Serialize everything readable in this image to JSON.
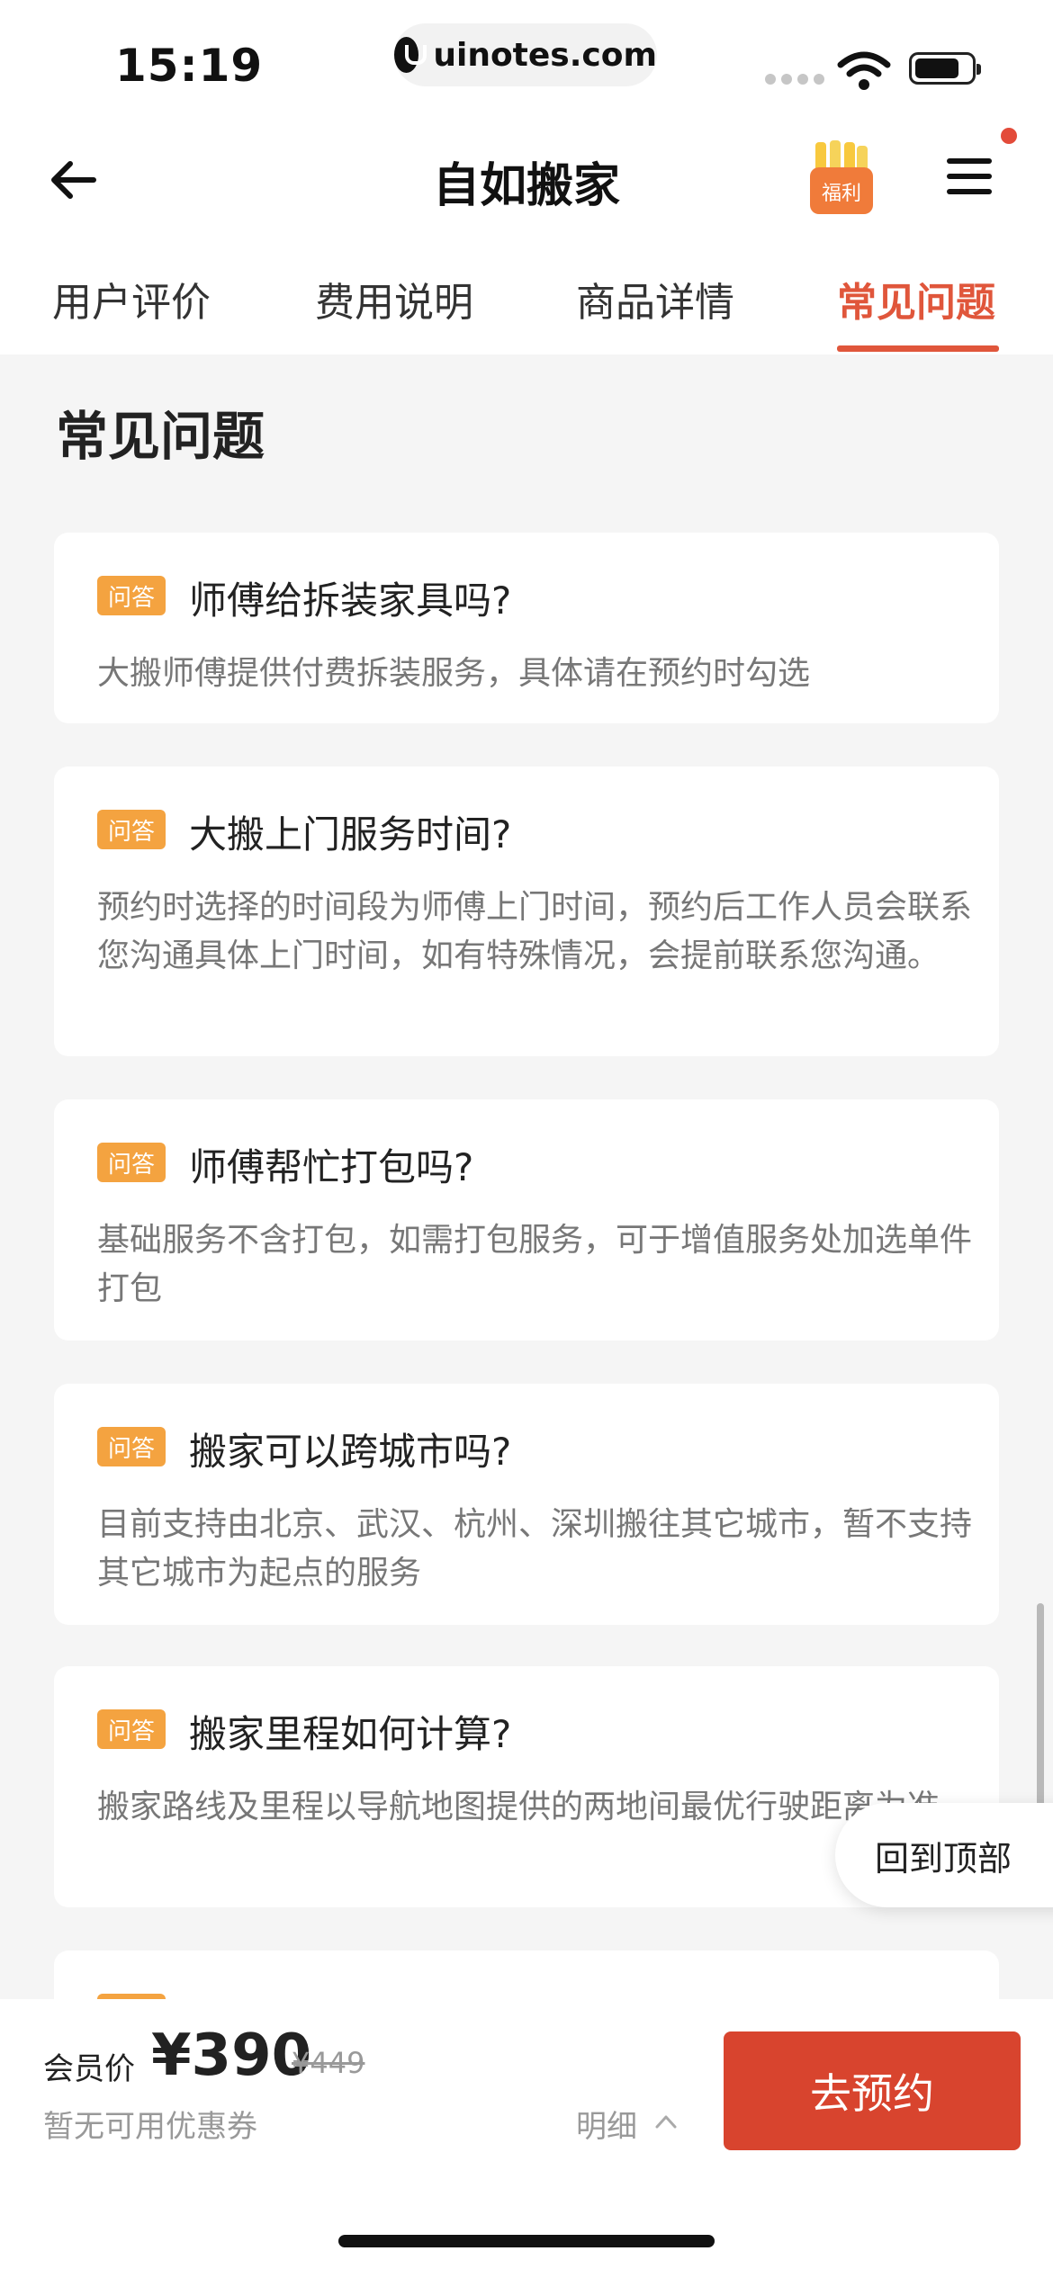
{
  "status": {
    "time": "15:19",
    "url": "uinotes.com"
  },
  "nav": {
    "title": "自如搬家",
    "fuli_label": "福利"
  },
  "tabs": [
    {
      "label": "用户评价",
      "active": false
    },
    {
      "label": "费用说明",
      "active": false
    },
    {
      "label": "商品详情",
      "active": false
    },
    {
      "label": "常见问题",
      "active": true
    }
  ],
  "section": {
    "title": "常见问题"
  },
  "badge_label": "问答",
  "faqs": [
    {
      "q": "师傅给拆装家具吗?",
      "a": "大搬师傅提供付费拆装服务，具体请在预约时勾选"
    },
    {
      "q": "大搬上门服务时间?",
      "a": "预约时选择的时间段为师傅上门时间，预约后工作人员会联系您沟通具体上门时间，如有特殊情况，会提前联系您沟通。"
    },
    {
      "q": "师傅帮忙打包吗?",
      "a": "基础服务不含打包，如需打包服务，可于增值服务处加选单件打包"
    },
    {
      "q": "搬家可以跨城市吗?",
      "a": "目前支持由北京、武汉、杭州、深圳搬往其它城市，暂不支持其它城市为起点的服务"
    },
    {
      "q": "搬家里程如何计算?",
      "a": "搬家路线及里程以导航地图提供的两地间最优行驶距离为准"
    }
  ],
  "back_to_top": "回到顶部",
  "bottom": {
    "member_label": "会员价",
    "price": "¥390",
    "original_price": "¥449",
    "coupon": "暂无可用优惠券",
    "detail": "明细",
    "book": "去预约"
  },
  "colors": {
    "accent": "#e0563b",
    "badge": "#f4a340",
    "button": "#d8442e"
  }
}
